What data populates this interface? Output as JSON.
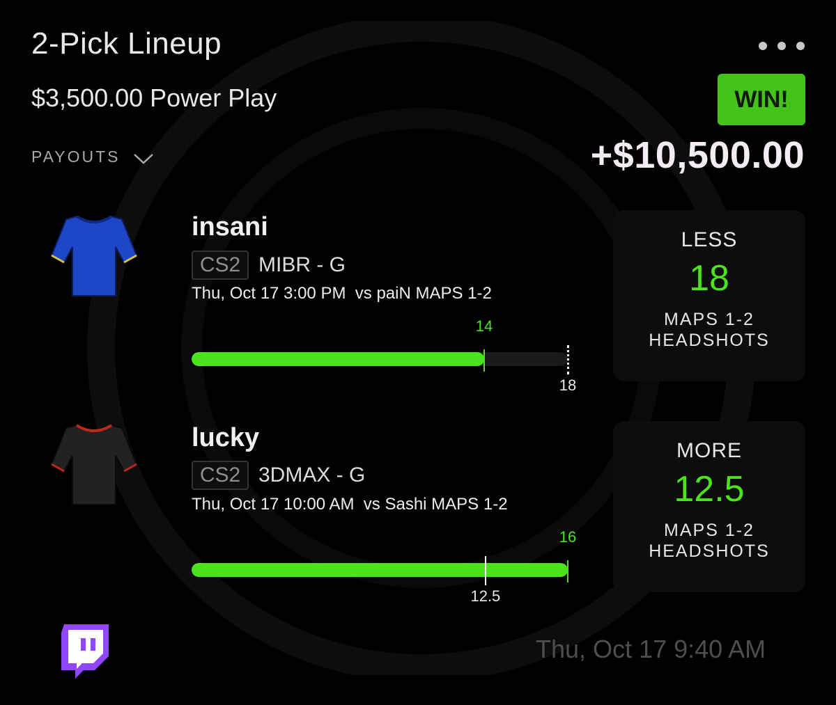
{
  "lineup": {
    "title": "2-Pick Lineup",
    "subtitle": "$3,500.00 Power Play",
    "payouts_label": "PAYOUTS",
    "result_badge": "WIN!",
    "payout_amount": "+$10,500.00"
  },
  "picks": [
    {
      "player": "insani",
      "game": "CS2",
      "team": "MIBR - G",
      "game_info": "Thu, Oct 17 3:00 PM  vs paiN MAPS 1-2",
      "current_value": "14",
      "line_value": "18",
      "progress": {
        "current": 14,
        "line": 18,
        "scale_max": 18
      },
      "direction": "LESS",
      "stat_line1": "MAPS 1-2",
      "stat_line2": "HEADSHOTS",
      "jersey_color": "#1e47c8"
    },
    {
      "player": "lucky",
      "game": "CS2",
      "team": "3DMAX - G",
      "game_info": "Thu, Oct 17 10:00 AM  vs Sashi MAPS 1-2",
      "current_value": "16",
      "line_value": "12.5",
      "progress": {
        "current": 16,
        "line": 12.5,
        "scale_max": 16
      },
      "direction": "MORE",
      "stat_line1": "MAPS 1-2",
      "stat_line2": "HEADSHOTS",
      "jersey_color": "#222222"
    }
  ],
  "footer": {
    "timestamp": "Thu, Oct 17 9:40 AM",
    "icon": "twitch-icon"
  },
  "colors": {
    "accent_green": "#4be31c",
    "win_badge": "#44c31a",
    "background": "#000000",
    "twitch_purple": "#9146ff"
  }
}
